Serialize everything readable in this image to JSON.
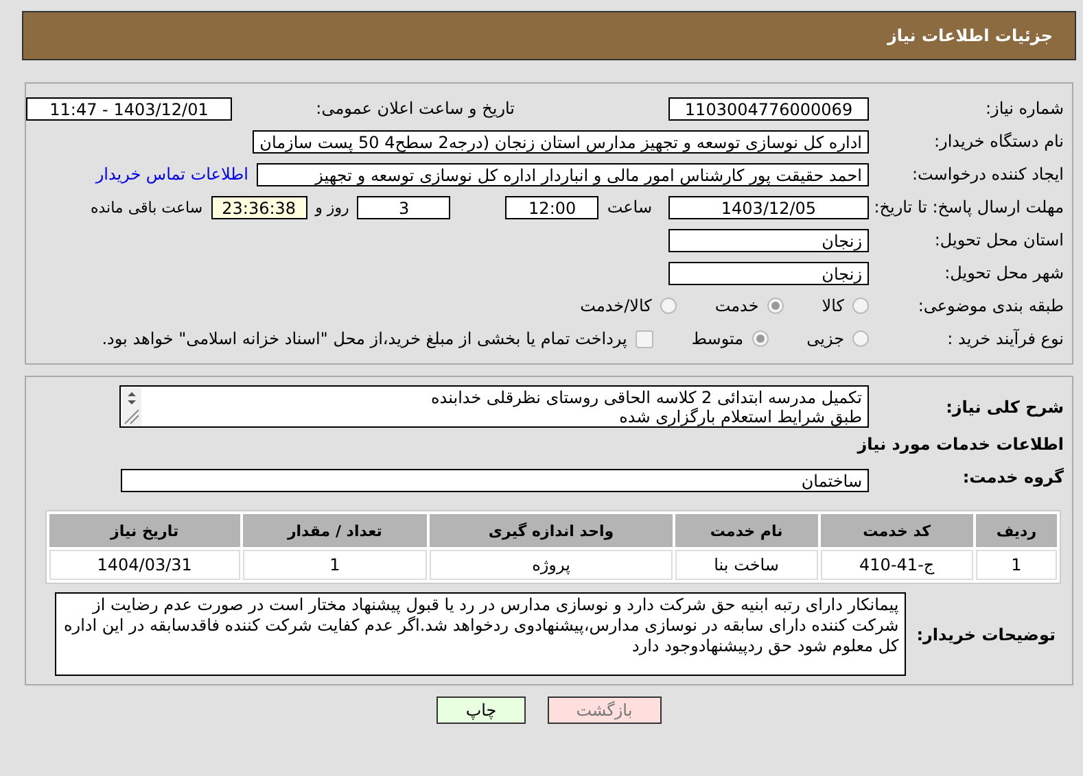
{
  "header": {
    "title": "جزئیات اطلاعات نیاز"
  },
  "details": {
    "need_number": {
      "label": "شماره نیاز:",
      "value": "1103004776000069"
    },
    "announce": {
      "label": "تاریخ و ساعت اعلان عمومی:",
      "value": "1403/12/01 - 11:47"
    },
    "buyer_org": {
      "label": "نام دستگاه خریدار:",
      "value": "اداره کل نوسازی   توسعه و تجهیز مدارس استان زنجان (درجه2  سطح4  50 پست سازمان"
    },
    "requester": {
      "label": "ایجاد کننده درخواست:",
      "value": "احمد حقیقت پور کارشناس امور مالی و انباردار اداره کل نوسازی   توسعه و تجهیز",
      "link": "اطلاعات تماس خریدار"
    },
    "deadline": {
      "label": "مهلت ارسال پاسخ: تا تاریخ:",
      "date": "1403/12/05",
      "time_label": "ساعت",
      "time": "12:00",
      "days": "3",
      "days_label": "روز و",
      "remaining": "23:36:38",
      "remaining_label": "ساعت باقی مانده"
    },
    "province": {
      "label": "استان محل تحویل:",
      "value": "زنجان"
    },
    "city": {
      "label": "شهر محل تحویل:",
      "value": "زنجان"
    },
    "category": {
      "label": "طبقه بندی موضوعی:",
      "options": [
        {
          "label": "کالا",
          "selected": false
        },
        {
          "label": "خدمت",
          "selected": true
        },
        {
          "label": "کالا/خدمت",
          "selected": false
        }
      ]
    },
    "process": {
      "label": "نوع فرآیند خرید :",
      "options": [
        {
          "label": "جزیی",
          "selected": false
        },
        {
          "label": "متوسط",
          "selected": true
        }
      ],
      "payment": {
        "checked": false,
        "text": "پرداخت تمام یا بخشی از مبلغ خرید،از محل \"اسناد خزانه اسلامی\" خواهد بود."
      }
    }
  },
  "summary": {
    "label": "شرح کلی نیاز:",
    "value": "تکمیل مدرسه ابتدائی 2 کلاسه الحاقی روستای نظرقلی خدابنده\nطبق شرایط استعلام بارگزاری شده"
  },
  "services_title": "اطلاعات خدمات مورد نیاز",
  "service_group": {
    "label": "گروه خدمت:",
    "value": "ساختمان"
  },
  "table": {
    "columns": [
      "ردیف",
      "کد خدمت",
      "نام خدمت",
      "واحد اندازه گیری",
      "تعداد / مقدار",
      "تاریخ نیاز"
    ],
    "rows": [
      [
        "1",
        "ج-41-410",
        "ساخت بنا",
        "پروژه",
        "1",
        "1404/03/31"
      ]
    ]
  },
  "notes": {
    "label": "توضیحات خریدار:",
    "value": "پیمانکار دارای رتبه ابنیه حق شرکت دارد و نوسازی مدارس در رد یا قبول پیشنهاد مختار است در صورت عدم رضایت از شرکت کننده دارای سابقه در نوسازی مدارس،پیشنهادوی ردخواهد شد.اگر عدم کفایت شرکت کننده فاقدسابقه در این اداره کل معلوم شود حق ردپیشنهادوجود دارد"
  },
  "buttons": [
    {
      "label": "بازگشت",
      "kind": "back"
    },
    {
      "label": "چاپ",
      "kind": "print"
    }
  ]
}
